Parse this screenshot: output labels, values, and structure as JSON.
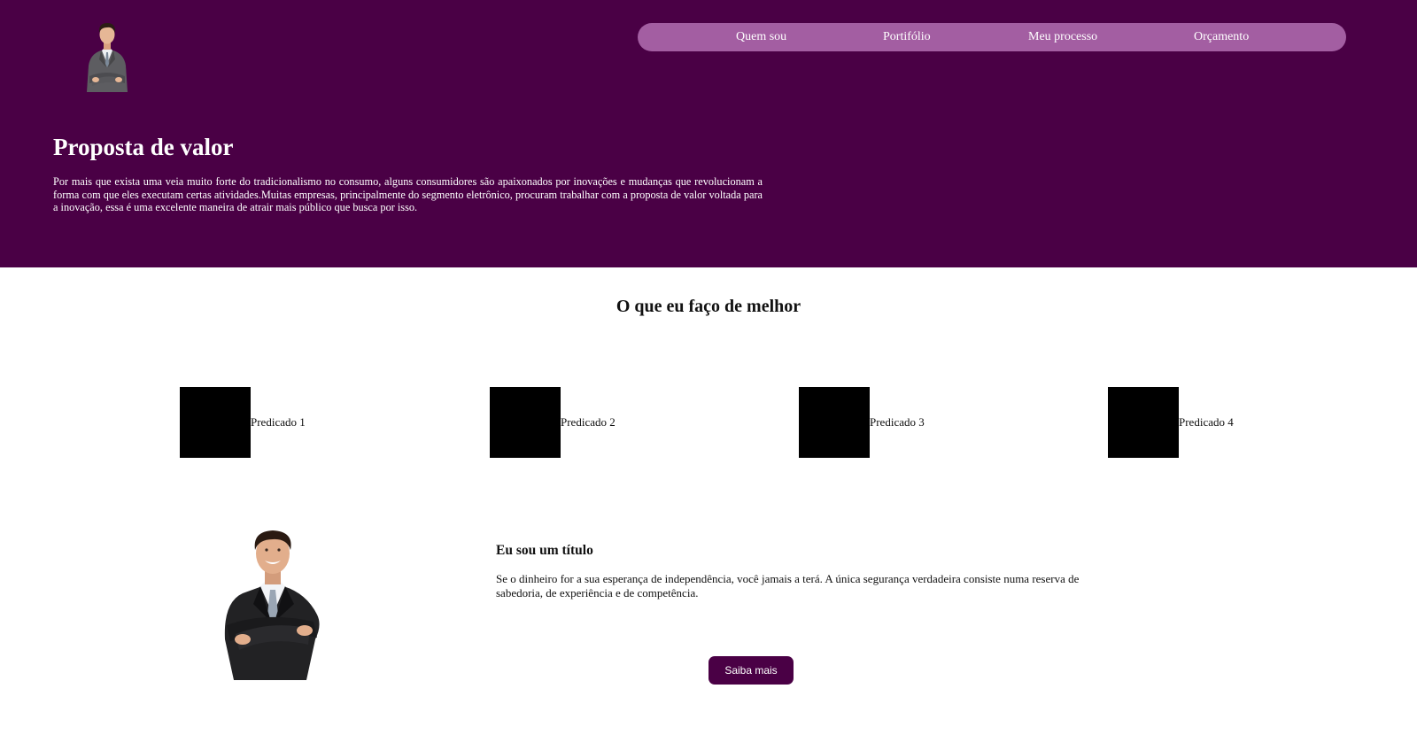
{
  "theme": {
    "primary": "#4a0045",
    "nav_background": "#a35ea2",
    "feature_square": "#000000",
    "text_dark": "#111111",
    "text_light": "#ffffff"
  },
  "header": {
    "logo_image": "businessman-avatar",
    "nav": [
      {
        "label": "Quem sou"
      },
      {
        "label": "Portifólio"
      },
      {
        "label": "Meu processo"
      },
      {
        "label": "Orçamento"
      }
    ]
  },
  "hero": {
    "title": "Proposta de valor",
    "text": "Por mais que exista uma veia muito forte do tradicionalismo no consumo, alguns consumidores são apaixonados por inovações e mudanças que revolucionam a forma com que eles executam certas atividades.Muitas empresas, principalmente do segmento eletrônico, procuram trabalhar com a proposta de valor voltada para a inovação, essa é uma excelente maneira de atrair mais público que busca por isso."
  },
  "services": {
    "title": "O que eu faço de melhor",
    "items": [
      {
        "label": "Predicado 1"
      },
      {
        "label": "Predicado 2"
      },
      {
        "label": "Predicado 3"
      },
      {
        "label": "Predicado 4"
      }
    ]
  },
  "about": {
    "image": "businessman-photo",
    "title": "Eu sou um título",
    "text": "Se o dinheiro for a sua esperança de independência, você jamais a terá. A única segurança verdadeira consiste numa reserva de sabedoria, de experiência e de competência.",
    "button_label": "Saiba mais"
  }
}
